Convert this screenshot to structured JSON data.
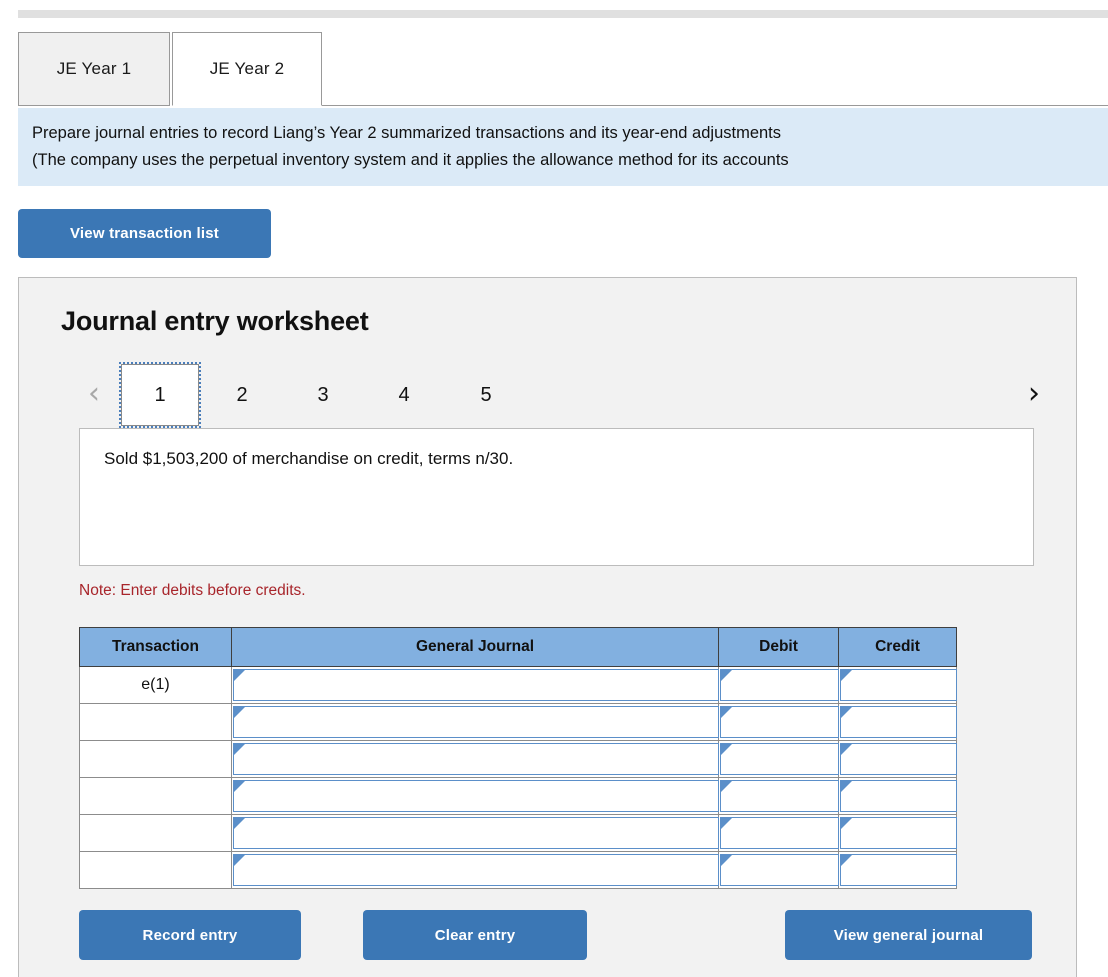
{
  "tabs": [
    {
      "label": "JE Year 1",
      "active": false
    },
    {
      "label": "JE Year 2",
      "active": true
    }
  ],
  "instructions": {
    "line1": "Prepare journal entries to record Liang’s Year 2 summarized transactions and its year-end adjustments",
    "line2": "(The company uses the perpetual inventory system and it applies the allowance method for its accounts"
  },
  "toolbar": {
    "view_transaction_list": "View transaction list"
  },
  "worksheet": {
    "title": "Journal entry worksheet",
    "pager": {
      "prev_icon": "‹",
      "next_icon": "›",
      "pages": [
        "1",
        "2",
        "3",
        "4",
        "5"
      ],
      "active_page": "1"
    },
    "transaction_text": "Sold $1,503,200 of merchandise on credit, terms n/30.",
    "note": "Note: Enter debits before credits.",
    "table": {
      "headers": [
        "Transaction",
        "General Journal",
        "Debit",
        "Credit"
      ],
      "rows": [
        {
          "transaction": "e(1)",
          "general_journal": "",
          "debit": "",
          "credit": ""
        },
        {
          "transaction": "",
          "general_journal": "",
          "debit": "",
          "credit": ""
        },
        {
          "transaction": "",
          "general_journal": "",
          "debit": "",
          "credit": ""
        },
        {
          "transaction": "",
          "general_journal": "",
          "debit": "",
          "credit": ""
        },
        {
          "transaction": "",
          "general_journal": "",
          "debit": "",
          "credit": ""
        },
        {
          "transaction": "",
          "general_journal": "",
          "debit": "",
          "credit": ""
        }
      ]
    },
    "actions": {
      "record_entry": "Record entry",
      "clear_entry": "Clear entry",
      "view_general_journal": "View general journal"
    }
  },
  "colors": {
    "button_blue": "#3b77b5",
    "table_header_blue": "#82b0e0",
    "instruction_bg": "#dbeaf7",
    "panel_bg": "#f2f2f2",
    "note_red": "#a8252b"
  }
}
